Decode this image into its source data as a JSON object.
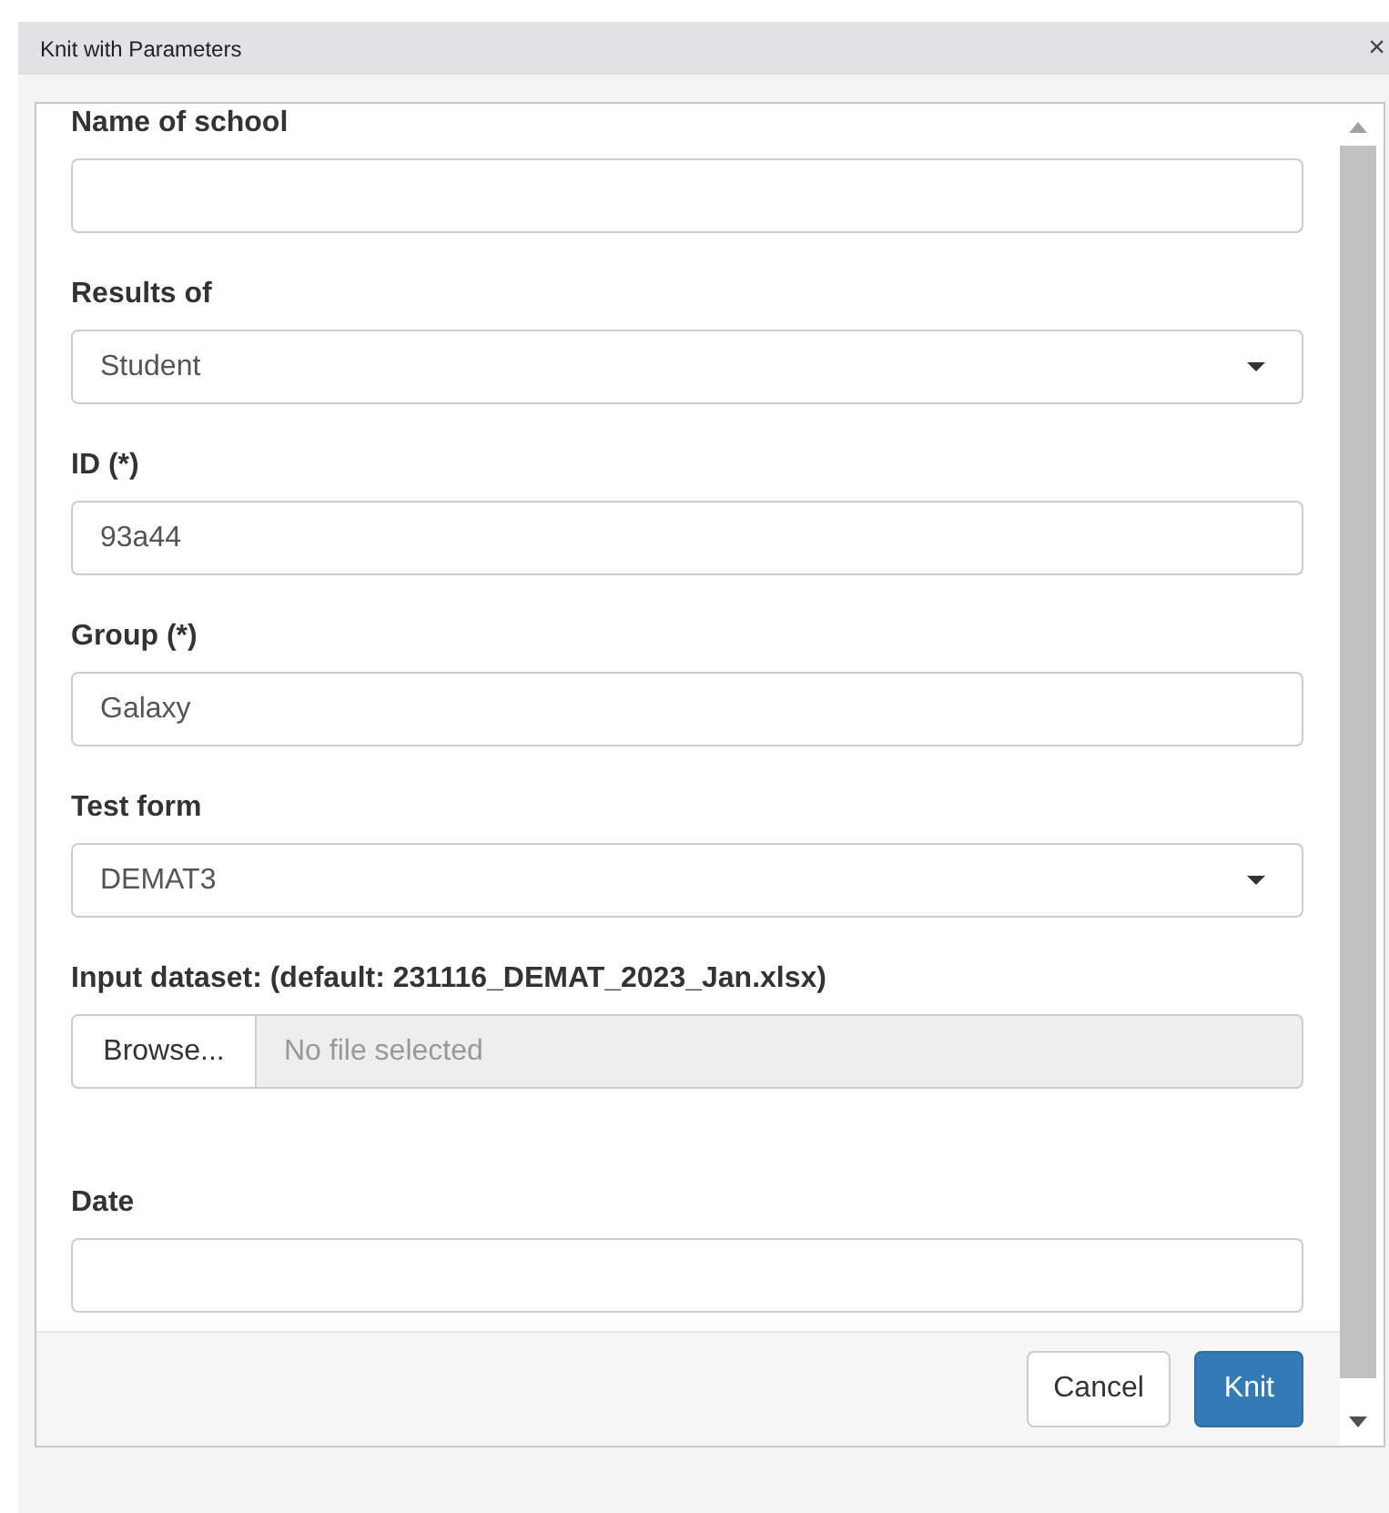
{
  "window": {
    "title": "Knit with Parameters",
    "close": "×"
  },
  "fields": [
    {
      "kind": "text",
      "label": "Name of school"
    },
    {
      "kind": "select",
      "label": "Results of",
      "value": "Student"
    },
    {
      "kind": "text",
      "label": "ID (*)",
      "value": "93a44"
    },
    {
      "kind": "text",
      "label": "Group (*)",
      "value": "Galaxy"
    },
    {
      "kind": "select",
      "label": "Test form",
      "value": "DEMAT3"
    },
    {
      "kind": "file",
      "label": "Input dataset: (default: 231116_DEMAT_2023_Jan.xlsx)",
      "button": "Browse...",
      "placeholder": "No file selected"
    },
    {
      "kind": "text",
      "label": "Date"
    }
  ],
  "buttons": [
    {
      "label": "Cancel",
      "primary": false
    },
    {
      "label": "Knit",
      "primary": true
    }
  ]
}
